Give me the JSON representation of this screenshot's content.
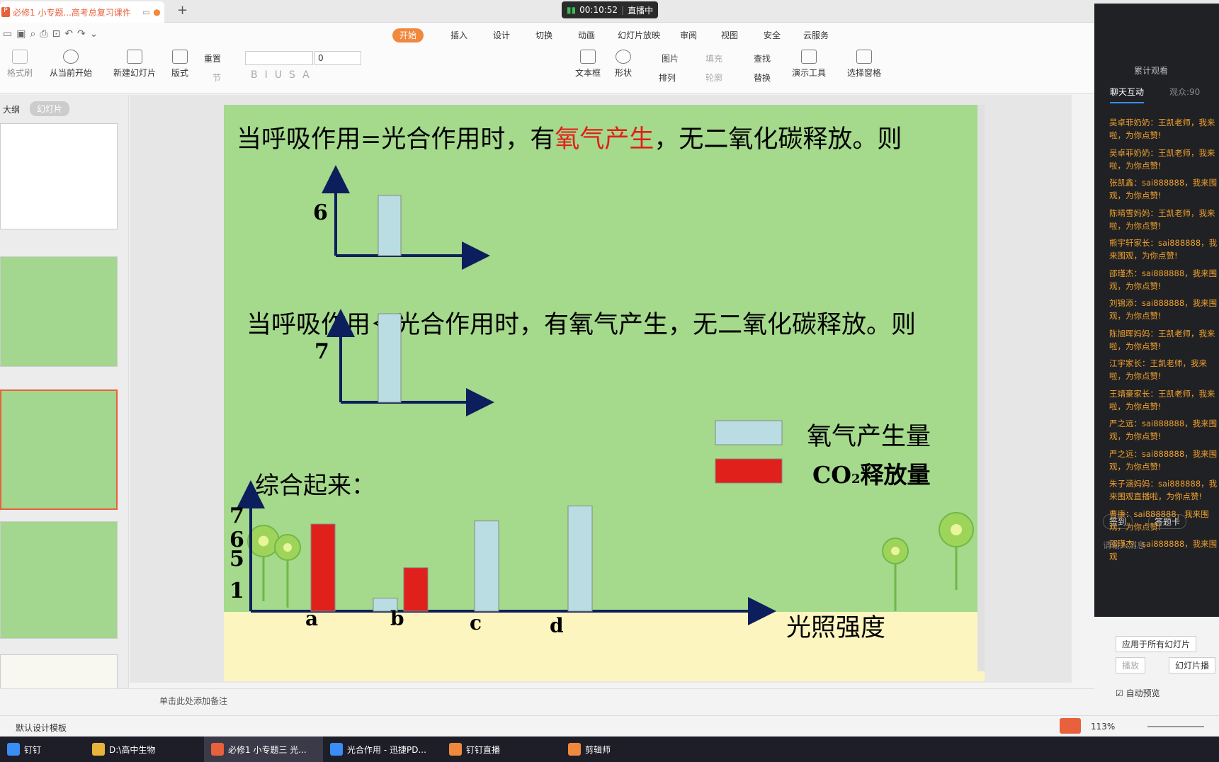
{
  "titlebar": {
    "doc_tab": "必修1 小专题...高考总复习课件",
    "new_tab": "+",
    "rec_time": "00:10:52",
    "rec_status": "直播中"
  },
  "menu_tabs": [
    "开始",
    "插入",
    "设计",
    "切换",
    "动画",
    "幻灯片放映",
    "审阅",
    "视图",
    "安全",
    "云服务"
  ],
  "ribbon": {
    "format_painter": "格式刷",
    "play_from_current": "从当前开始",
    "new_slide": "新建幻灯片",
    "layout": "版式",
    "reset": "重置",
    "section": "节",
    "font_size": "0",
    "text_box": "文本框",
    "shape": "形状",
    "picture": "图片",
    "arrange": "排列",
    "fill": "填充",
    "outline": "轮廓",
    "find": "查找",
    "replace": "替换",
    "presenter_tools": "演示工具",
    "selection_pane": "选择窗格"
  },
  "left_tabs": {
    "outline": "大纲",
    "slides": "幻灯片"
  },
  "slide": {
    "line1_a": "当呼吸作用=光合作用时，有",
    "line1_red": "氧气产生",
    "line1_b": "，无二氧化碳释放。则",
    "line2": "当呼吸作用＜光合作用时，有氧气产生，无二氧化碳释放。则",
    "summary": "综合起来：",
    "legend_o2": "氧气产生量",
    "legend_co2_a": "CO",
    "legend_co2_sub": "2",
    "legend_co2_b": "释放量",
    "xaxis": "光照强度",
    "chart1_label": "6",
    "chart2_label": "7",
    "y_labels": [
      "7",
      "6",
      "5",
      "1"
    ],
    "cats": [
      "a",
      "b",
      "c",
      "d"
    ]
  },
  "chart_data": [
    {
      "type": "bar",
      "categories": [
        ""
      ],
      "series": [
        {
          "name": "氧气产生量",
          "values": [
            6
          ]
        }
      ],
      "ylabel": "6"
    },
    {
      "type": "bar",
      "categories": [
        ""
      ],
      "series": [
        {
          "name": "氧气产生量",
          "values": [
            7
          ]
        }
      ],
      "ylabel": "7"
    },
    {
      "type": "bar",
      "categories": [
        "a",
        "b",
        "c",
        "d"
      ],
      "series": [
        {
          "name": "氧气产生量",
          "values": [
            0,
            1,
            6,
            7
          ]
        },
        {
          "name": "CO2释放量",
          "values": [
            6,
            5,
            0,
            0
          ]
        }
      ],
      "xlabel": "光照强度",
      "yticks": [
        1,
        5,
        6,
        7
      ]
    }
  ],
  "notes_placeholder": "单击此处添加备注",
  "status": {
    "template": "默认设计模板",
    "zoom": "113%"
  },
  "right": {
    "watch_count": "累计观看",
    "tab_chat": "聊天互动",
    "tab_viewers": "观众:90",
    "messages": [
      "吴卓菲奶奶：王凯老师，我来啦，为你点赞!",
      "吴卓菲奶奶：王凯老师，我来啦，为你点赞!",
      "张凯鑫：sai888888，我来围观，为你点赞!",
      "陈晴雪妈妈：王凯老师，我来啦，为你点赞!",
      "熊宇轩家长：sai888888，我来围观，为你点赞!",
      "邵瑾杰：sai888888，我来围观，为你点赞!",
      "刘锦添：sai888888，我来围观，为你点赞!",
      "陈旭晖妈妈：王凯老师，我来啦，为你点赞!",
      "江宇家长：王凯老师，我来啦，为你点赞!",
      "王靖豪家长：王凯老师，我来啦，为你点赞!",
      "严之远：sai888888，我来围观，为你点赞!",
      "严之远：sai888888，我来围观，为你点赞!",
      "朱子涵妈妈：sai888888，我来围观直播啦，为你点赞!",
      "曹康：sai888888，我来围观，为你点赞!",
      "邵瑾杰：sai888888，我来围观"
    ],
    "checkin": "签到",
    "answer_card": "答题卡",
    "input_placeholder": "请输入消息",
    "apply_all": "应用于所有幻灯片",
    "play": "播放",
    "slide_play": "幻灯片播",
    "auto_preview": "自动预览"
  },
  "taskbar": [
    "钉钉",
    "D:\\高中生物",
    "必修1 小专题三 光...",
    "光合作用 - 迅捷PD...",
    "钉钉直播",
    "剪辑师"
  ],
  "colors": {
    "o2": "#b9dde3",
    "co2": "#e0201a",
    "axis": "#0c1f5c",
    "slide_bg": "#a5d98c",
    "ground": "#fdf5c0",
    "accent": "#f0883e"
  }
}
